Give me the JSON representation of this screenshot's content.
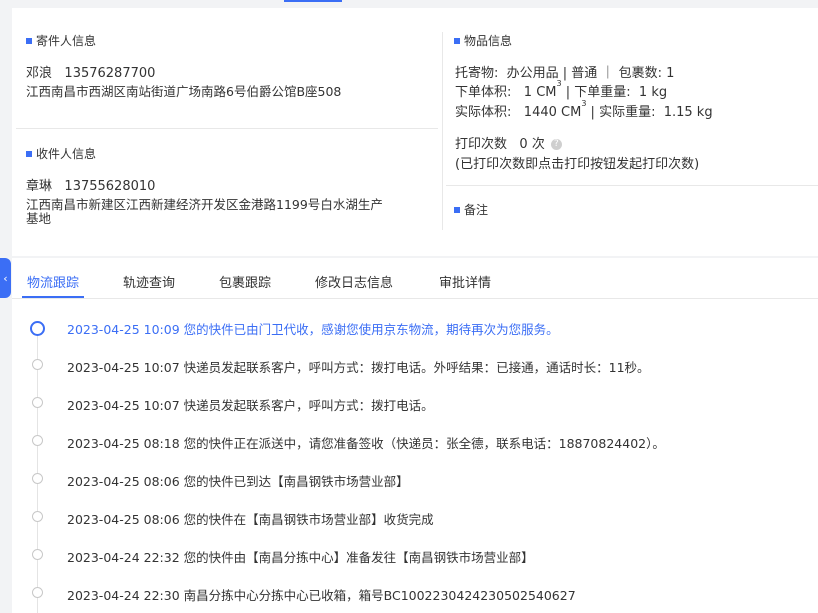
{
  "sender": {
    "title": "寄件人信息",
    "name": "邓浪",
    "phone": "13576287700",
    "address": "江西南昌市西湖区南站街道广场南路6号伯爵公馆B座508"
  },
  "receiver": {
    "title": "收件人信息",
    "name": "章琳",
    "phone": "13755628010",
    "address_line1": "江西南昌市新建区江西新建经济开发区金港路1199号白水湖生产",
    "address_line2": "基地"
  },
  "item": {
    "title": "物品信息",
    "goods_label": "托寄物:",
    "goods_value": "办公用品 | 普通 ｜ 包裹数:  1",
    "order_volume_label": "下单体积:",
    "order_volume_value": "1 CM",
    "order_weight_label": "下单重量:",
    "order_weight_value": "1 kg",
    "actual_volume_label": "实际体积:",
    "actual_volume_value": "1440 CM",
    "actual_weight_label": "实际重量:",
    "actual_weight_value": "1.15 kg",
    "cube_sup": "3",
    "sep": "|",
    "print_count_label": "打印次数",
    "print_count_value": "0 次",
    "help_glyph": "?",
    "print_hint": "(已打印次数即点击打印按钮发起打印次数)"
  },
  "remark": {
    "title": "备注"
  },
  "collapse_icon": "‹",
  "tabs": [
    {
      "label": "物流跟踪"
    },
    {
      "label": "轨迹查询"
    },
    {
      "label": "包裹跟踪"
    },
    {
      "label": "修改日志信息"
    },
    {
      "label": "审批详情"
    }
  ],
  "events": [
    {
      "text": "2023-04-25 10:09  您的快件已由门卫代收，感谢您使用京东物流，期待再次为您服务。"
    },
    {
      "text": "2023-04-25 10:07  快递员发起联系客户，呼叫方式：拨打电话。外呼结果：已接通，通话时长：11秒。"
    },
    {
      "text": "2023-04-25 10:07  快递员发起联系客户，呼叫方式：拨打电话。"
    },
    {
      "text": "2023-04-25 08:18  您的快件正在派送中，请您准备签收（快递员：张全德，联系电话：18870824402）。"
    },
    {
      "text": "2023-04-25 08:06  您的快件已到达【南昌钢铁市场营业部】"
    },
    {
      "text": "2023-04-25 08:06  您的快件在【南昌钢铁市场营业部】收货完成"
    },
    {
      "text": "2023-04-24 22:32  您的快件由【南昌分拣中心】准备发往【南昌钢铁市场营业部】"
    },
    {
      "text": "2023-04-24 22:30  南昌分拣中心分拣中心已收箱，箱号BC1002230424230502540627"
    }
  ],
  "colors": {
    "accent": "#3b6ef5",
    "text": "#333333",
    "muted_dot": "#c8c8c8"
  }
}
